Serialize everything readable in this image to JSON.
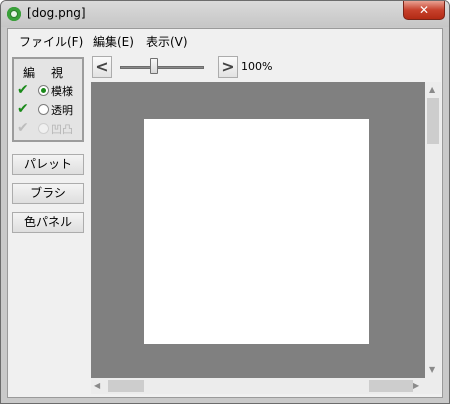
{
  "window": {
    "title": "[dog.png]",
    "close_label": "✕"
  },
  "menu": [
    "ファイル(F)",
    "編集(E)",
    "表示(V)"
  ],
  "layers": {
    "header_edit": "編",
    "header_view": "視",
    "rows": [
      {
        "label": "模様",
        "edit_checked": true,
        "view_selected": true,
        "enabled": true
      },
      {
        "label": "透明",
        "edit_checked": true,
        "view_selected": false,
        "enabled": true
      },
      {
        "label": "凹凸",
        "edit_checked": true,
        "view_selected": false,
        "enabled": false
      }
    ]
  },
  "side_buttons": [
    "パレット",
    "ブラシ",
    "色パネル"
  ],
  "toolbar": {
    "prev_label": "<",
    "next_label": ">",
    "zoom": "100%",
    "zoom_fraction": 0.47
  },
  "canvas": {
    "background": "#808080",
    "image_color": "#ffffff"
  },
  "scroll": {
    "up": "▲",
    "down": "▼",
    "left": "◀",
    "right": "▶"
  }
}
